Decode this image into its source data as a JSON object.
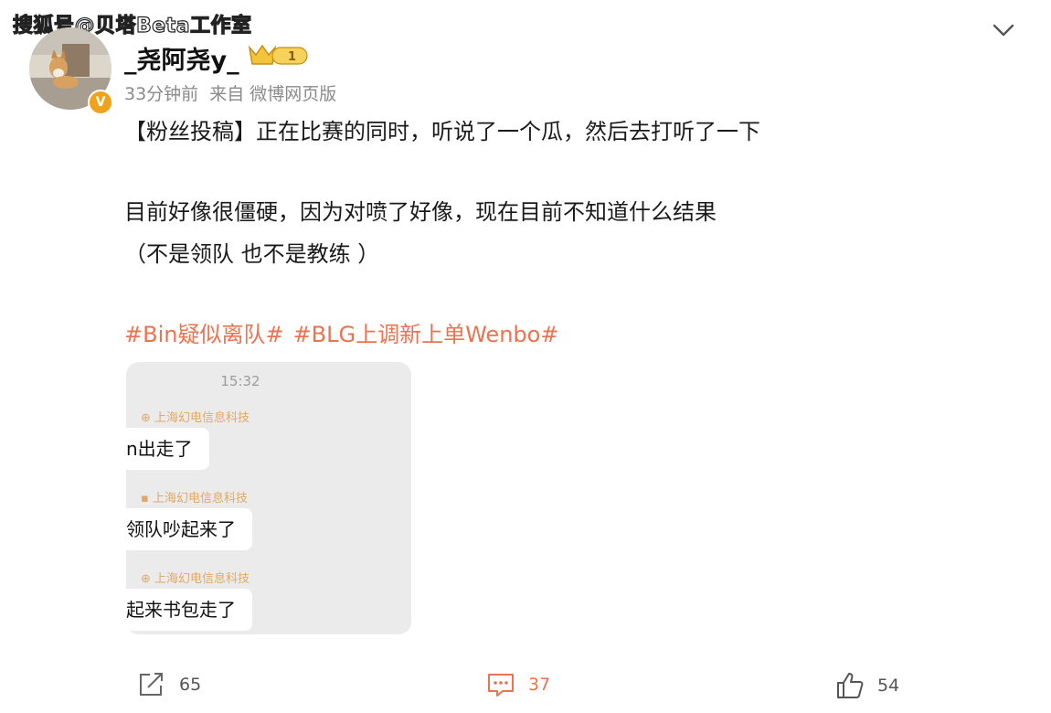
{
  "watermark": "搜狐号@贝塔Beta工作室",
  "post": {
    "username": "_尧阿尧y_",
    "badge_level": "1",
    "time": "33分钟前",
    "source_prefix": "来自",
    "source": "微博网页版",
    "line1": "【粉丝投稿】正在比赛的同时，听说了一个瓜，然后去打听了一下",
    "line2": "目前好像很僵硬，因为对喷了好像，现在目前不知道什么结果",
    "line3": "（不是领队 也不是教练 ）",
    "hashtags": [
      "#Bin疑似离队#",
      "#BLG上调新上单Wenbo#"
    ]
  },
  "chat": {
    "time": "15:32",
    "messages": [
      {
        "sender": "上海幻电信息科技",
        "text": "n出走了"
      },
      {
        "sender": "上海幻电信息科技",
        "text": "领队吵起来了"
      },
      {
        "sender": "上海幻电信息科技",
        "text": "起来书包走了"
      }
    ]
  },
  "actions": {
    "repost_count": "65",
    "comment_count": "37",
    "like_count": "54"
  },
  "icons": {
    "expand": "chevron-down-icon",
    "verified": "verified-badge-icon",
    "crown": "crown-level-icon",
    "repost": "share-icon",
    "comment": "comment-icon",
    "like": "thumbs-up-icon"
  },
  "colors": {
    "hashtag": "#eb7350",
    "verified": "#f0a21b",
    "meta": "#8a8a8a"
  }
}
